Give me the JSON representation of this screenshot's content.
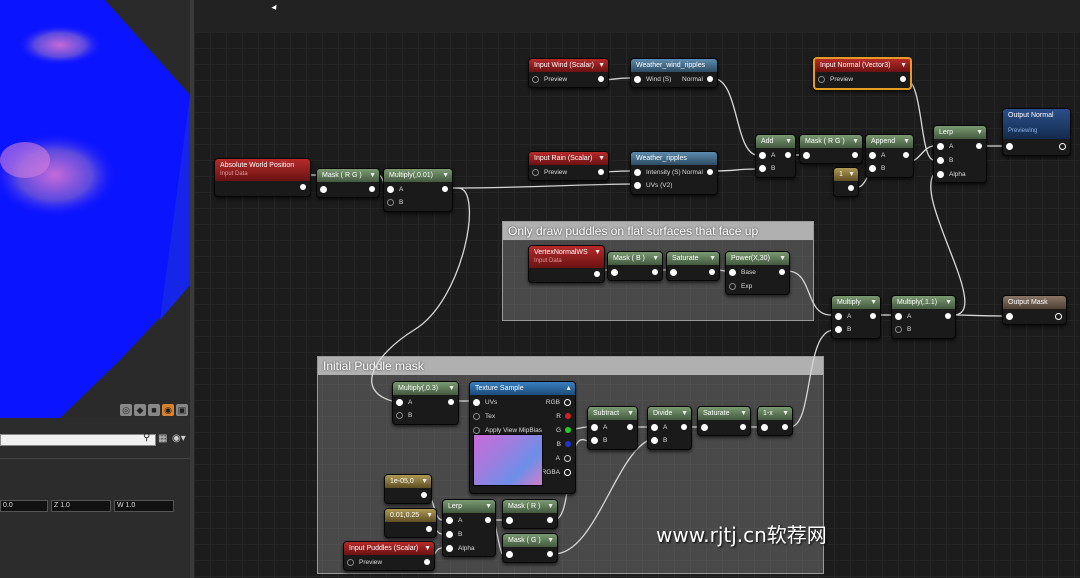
{
  "colors": {
    "accent": "#e69b22",
    "param_header": "#b72b2b",
    "math_header": "#5c7a55",
    "function_header": "#4f7ea3",
    "texture_header": "#2f6fae",
    "constant_header": "#9a8547",
    "output_header": "#22406f"
  },
  "viewport": {
    "tool_buttons": [
      "perspective-icon",
      "lit-icon",
      "realtime-icon",
      "show-icon",
      "camera-icon"
    ]
  },
  "details": {
    "search_placeholder": "",
    "coords": {
      "z": "Z 1.0",
      "w": "W 1.0",
      "first": "0.0"
    }
  },
  "comments": {
    "puddle_mask": "Initial Puddle mask",
    "flat_surfaces": "Only draw puddles on flat surfaces that face up"
  },
  "nodes": {
    "input_wind": {
      "title": "Input Wind (Scalar)",
      "preview": "Preview"
    },
    "weather_wind_ripples": {
      "title": "Weather_wind_ripples",
      "in": "Wind (S)",
      "out": "Normal"
    },
    "input_normal": {
      "title": "Input Normal (Vector3)",
      "preview": "Preview"
    },
    "input_rain": {
      "title": "Input Rain (Scalar)",
      "preview": "Preview"
    },
    "weather_ripples": {
      "title": "Weather_ripples",
      "in1": "Intensity (S)",
      "out": "Normal",
      "in2": "UVs (V2)"
    },
    "absolute_world_position": {
      "title": "Absolute World Position",
      "subtitle": "Input Data"
    },
    "mask_rg_1": {
      "title": "Mask ( R G )"
    },
    "multiply_001": {
      "title": "Multiply(,0.01)",
      "a": "A",
      "b": "B"
    },
    "add": {
      "title": "Add",
      "a": "A",
      "b": "B"
    },
    "mask_rg_2": {
      "title": "Mask ( R G )"
    },
    "append": {
      "title": "Append",
      "a": "A",
      "b": "B"
    },
    "const_1": {
      "title": "1"
    },
    "lerp_top": {
      "title": "Lerp",
      "a": "A",
      "b": "B",
      "alpha": "Alpha"
    },
    "output_normal": {
      "title": "Output Normal",
      "subtitle": "Previewing"
    },
    "vertex_normal": {
      "title": "VertexNormalWS",
      "subtitle": "Input Data"
    },
    "mask_b": {
      "title": "Mask ( B )"
    },
    "saturate_1": {
      "title": "Saturate"
    },
    "power": {
      "title": "Power(X,30)",
      "base": "Base",
      "exp": "Exp"
    },
    "multiply_mid": {
      "title": "Multiply",
      "a": "A",
      "b": "B"
    },
    "multiply_11": {
      "title": "Multiply(,1.1)",
      "a": "A",
      "b": "B"
    },
    "output_mask": {
      "title": "Output Mask"
    },
    "multiply_03": {
      "title": "Multiply(,0.3)",
      "a": "A",
      "b": "B"
    },
    "texture_sample": {
      "title": "Texture Sample",
      "uvs": "UVs",
      "tex": "Tex",
      "mip": "Apply View MipBias",
      "rgb": "RGB",
      "r": "R",
      "g": "G",
      "b": "B",
      "a": "A",
      "rgba": "RGBA"
    },
    "subtract": {
      "title": "Subtract",
      "a": "A",
      "b": "B"
    },
    "divide": {
      "title": "Divide",
      "a": "A",
      "b": "B"
    },
    "saturate_2": {
      "title": "Saturate"
    },
    "one_minus": {
      "title": "1-x"
    },
    "const_1e05": {
      "title": "1e-05,0"
    },
    "const_001_025": {
      "title": "0.01,0.25"
    },
    "lerp_bottom": {
      "title": "Lerp",
      "a": "A",
      "b": "B",
      "alpha": "Alpha"
    },
    "mask_r": {
      "title": "Mask ( R )"
    },
    "mask_g": {
      "title": "Mask ( G )"
    },
    "input_puddles": {
      "title": "Input Puddles (Scalar)",
      "preview": "Preview"
    }
  },
  "watermark": "www.rjtj.cn软荐网"
}
